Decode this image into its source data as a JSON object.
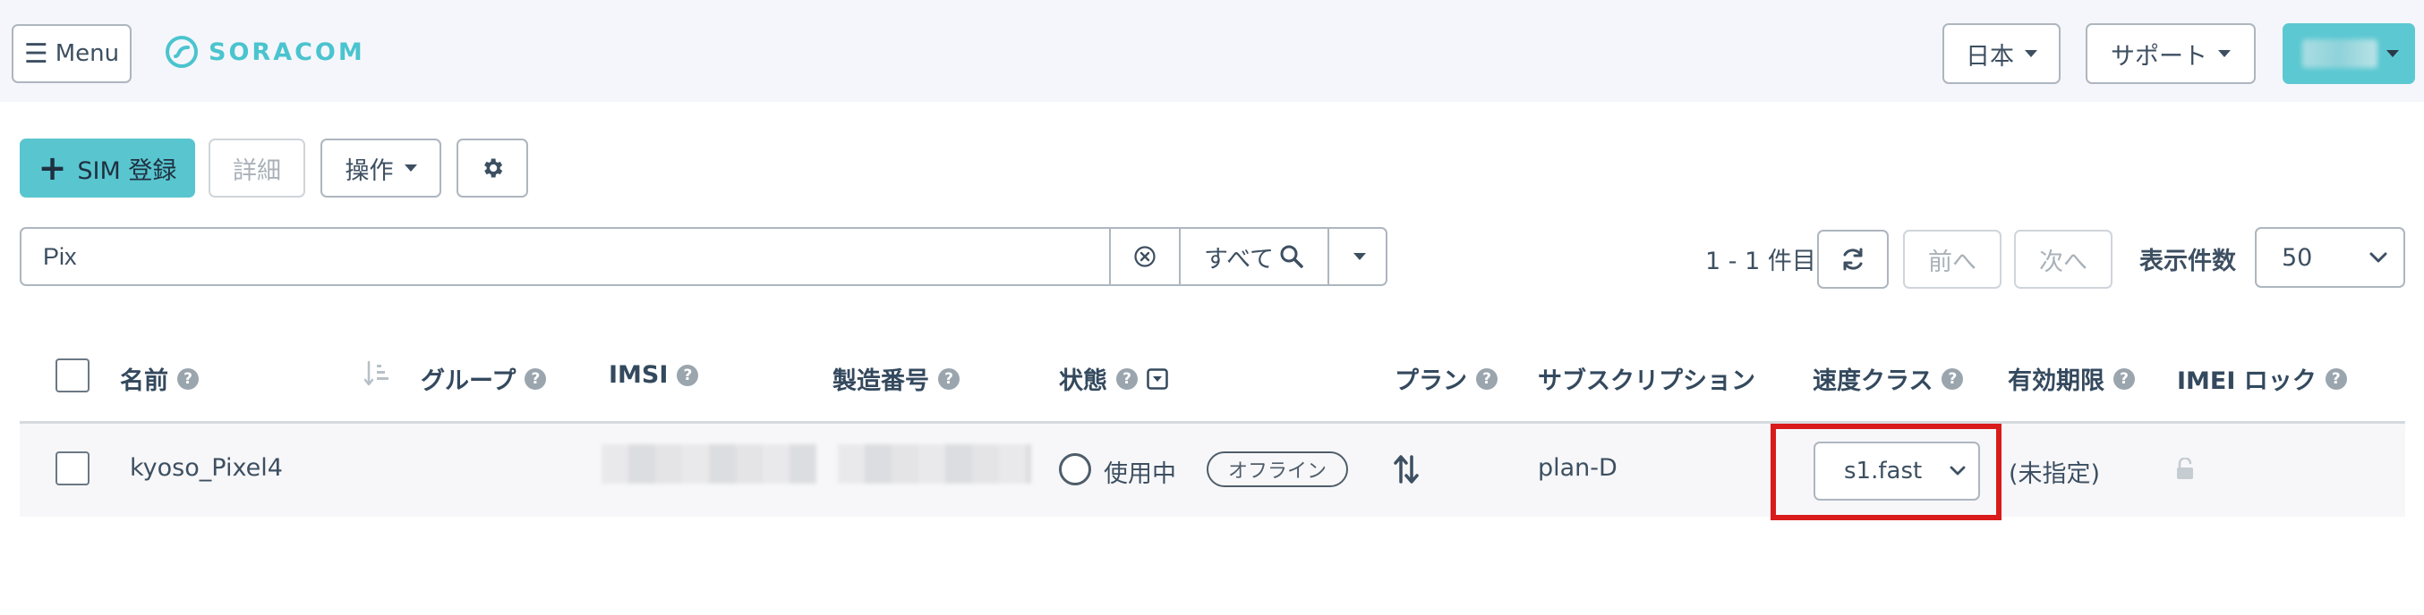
{
  "header": {
    "menu_label": "Menu",
    "brand": "SORACOM",
    "brand_color": "#4ac4cf",
    "language_label": "日本",
    "support_label": "サポート"
  },
  "toolbar": {
    "register_sim_label": "SIM 登録",
    "details_label": "詳細",
    "operations_label": "操作",
    "settings_icon": "gear-icon"
  },
  "search": {
    "value": "Pix",
    "scope_label": "すべて"
  },
  "pagination": {
    "range_text": "1 - 1 件目",
    "prev_label": "前へ",
    "next_label": "次へ",
    "per_page_label": "表示件数",
    "per_page_value": "50"
  },
  "table": {
    "columns": {
      "name": "名前",
      "group": "グループ",
      "imsi": "IMSI",
      "serial": "製造番号",
      "status": "状態",
      "plan": "プラン",
      "subscription": "サブスクリプション",
      "speed_class": "速度クラス",
      "expiry": "有効期限",
      "imei_lock": "IMEI ロック"
    },
    "rows": [
      {
        "name": "kyoso_Pixel4",
        "status": "使用中",
        "connection": "オフライン",
        "subscription": "plan-D",
        "speed_class": "s1.fast",
        "expiry": "(未指定)"
      }
    ]
  },
  "colors": {
    "accent": "#59c5cf",
    "highlight": "#d91b1b"
  }
}
